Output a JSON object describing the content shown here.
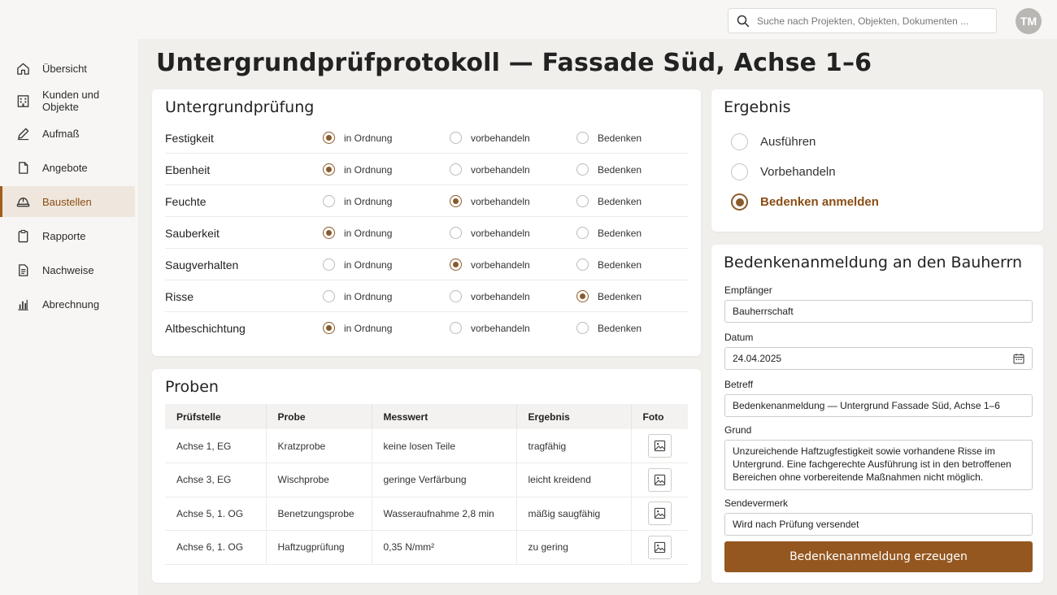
{
  "header": {
    "search_placeholder": "Suche nach Projekten, Objekten, Dokumenten ...",
    "avatar_initials": "TM"
  },
  "sidebar": {
    "items": [
      {
        "label": "Übersicht",
        "icon": "home-icon"
      },
      {
        "label": "Kunden und Objekte",
        "icon": "building-icon"
      },
      {
        "label": "Aufmaß",
        "icon": "pencil-ruler-icon"
      },
      {
        "label": "Angebote",
        "icon": "document-icon"
      },
      {
        "label": "Baustellen",
        "icon": "helmet-icon",
        "active": true
      },
      {
        "label": "Rapporte",
        "icon": "clipboard-icon"
      },
      {
        "label": "Nachweise",
        "icon": "checklist-icon"
      },
      {
        "label": "Abrechnung",
        "icon": "bar-chart-icon"
      }
    ]
  },
  "page": {
    "title": "Untergrundprüfprotokoll — Fassade Süd, Achse 1–6"
  },
  "inspection": {
    "title": "Untergrundprüfung",
    "options": [
      "in Ordnung",
      "vorbehandeln",
      "Bedenken"
    ],
    "rows": [
      {
        "label": "Festigkeit",
        "selected": 0
      },
      {
        "label": "Ebenheit",
        "selected": 0
      },
      {
        "label": "Feuchte",
        "selected": 1
      },
      {
        "label": "Sauberkeit",
        "selected": 0
      },
      {
        "label": "Saugverhalten",
        "selected": 1
      },
      {
        "label": "Risse",
        "selected": 2
      },
      {
        "label": "Altbeschichtung",
        "selected": 0
      }
    ]
  },
  "samples": {
    "title": "Proben",
    "columns": [
      "Prüfstelle",
      "Probe",
      "Messwert",
      "Ergebnis",
      "Foto"
    ],
    "rows": [
      [
        "Achse 1, EG",
        "Kratzprobe",
        "keine losen Teile",
        "tragfähig"
      ],
      [
        "Achse 3, EG",
        "Wischprobe",
        "geringe Verfärbung",
        "leicht kreidend"
      ],
      [
        "Achse 5, 1. OG",
        "Benetzungsprobe",
        "Wasseraufnahme 2,8 min",
        "mäßig saugfähig"
      ],
      [
        "Achse 6, 1. OG",
        "Haftzugprüfung",
        "0,35 N/mm²",
        "zu gering"
      ]
    ]
  },
  "result": {
    "title": "Ergebnis",
    "options": [
      "Ausführen",
      "Vorbehandeln",
      "Bedenken anmelden"
    ],
    "selected": 2
  },
  "notice": {
    "title": "Bedenkenanmeldung an den Bauherrn",
    "recipient_label": "Empfänger",
    "recipient_value": "Bauherrschaft",
    "date_label": "Datum",
    "date_value": "24.04.2025",
    "subject_label": "Betreff",
    "subject_value": "Bedenkenanmeldung — Untergrund Fassade Süd, Achse 1–6",
    "reason_label": "Grund",
    "reason_value": "Unzureichende Haftzugfestigkeit sowie vorhandene Risse im Untergrund. Eine fachgerechte Ausführung ist in den betroffenen Bereichen ohne vorbereitende Maßnahmen nicht möglich.",
    "dispatch_label": "Sendevermerk",
    "dispatch_value": "Wird nach Prüfung versendet",
    "submit_label": "Bedenkenanmeldung erzeugen"
  },
  "colors": {
    "accent": "#94571f",
    "radio_selected": "#8a5a2b",
    "active_nav_bg": "#efe7dd"
  }
}
